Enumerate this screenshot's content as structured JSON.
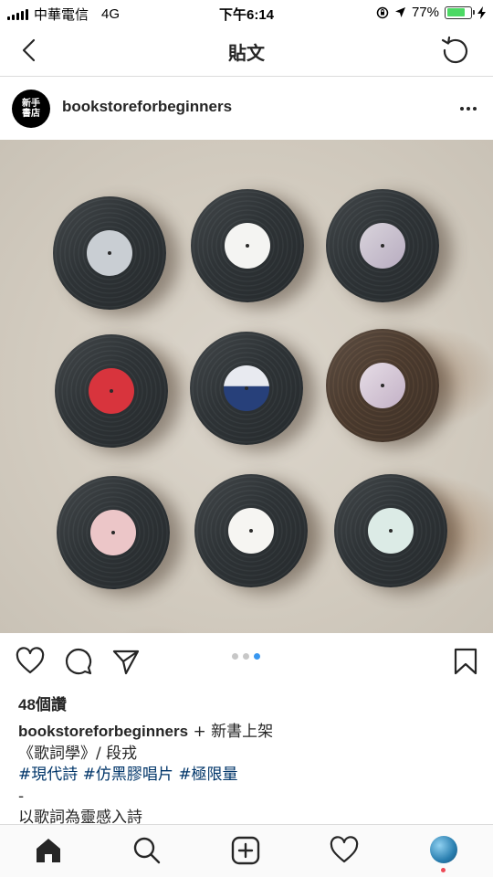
{
  "status_bar": {
    "carrier": "中華電信",
    "network": "4G",
    "time": "下午6:14",
    "battery_percent": "77%",
    "battery_level": 0.77
  },
  "nav": {
    "title": "貼文",
    "back_icon": "chevron-left-icon",
    "refresh_icon": "refresh-icon"
  },
  "post": {
    "avatar_text_line1": "新手",
    "avatar_text_line2": "書店",
    "username": "bookstoreforbeginners",
    "more_icon": "more-horizontal-icon",
    "carousel": {
      "count": 3,
      "active": 3
    }
  },
  "engagement": {
    "likes": "48個讚"
  },
  "caption": {
    "username": "bookstoreforbeginners",
    "line1_text": " + 新書上架",
    "line2": "《歌詞學》/ 段戎",
    "hashtags": [
      "#現代詩",
      "#仿黑膠唱片",
      "#極限量"
    ],
    "line4": "-",
    "line5": "以歌詞為靈感入詩"
  },
  "tab_bar": {
    "items": [
      "home-icon",
      "search-icon",
      "add-post-icon",
      "heart-icon",
      "profile-icon"
    ]
  },
  "colors": {
    "accent": "#3897f0",
    "hashtag": "#003569",
    "battery": "#4cd964",
    "notification": "#ed4956"
  }
}
